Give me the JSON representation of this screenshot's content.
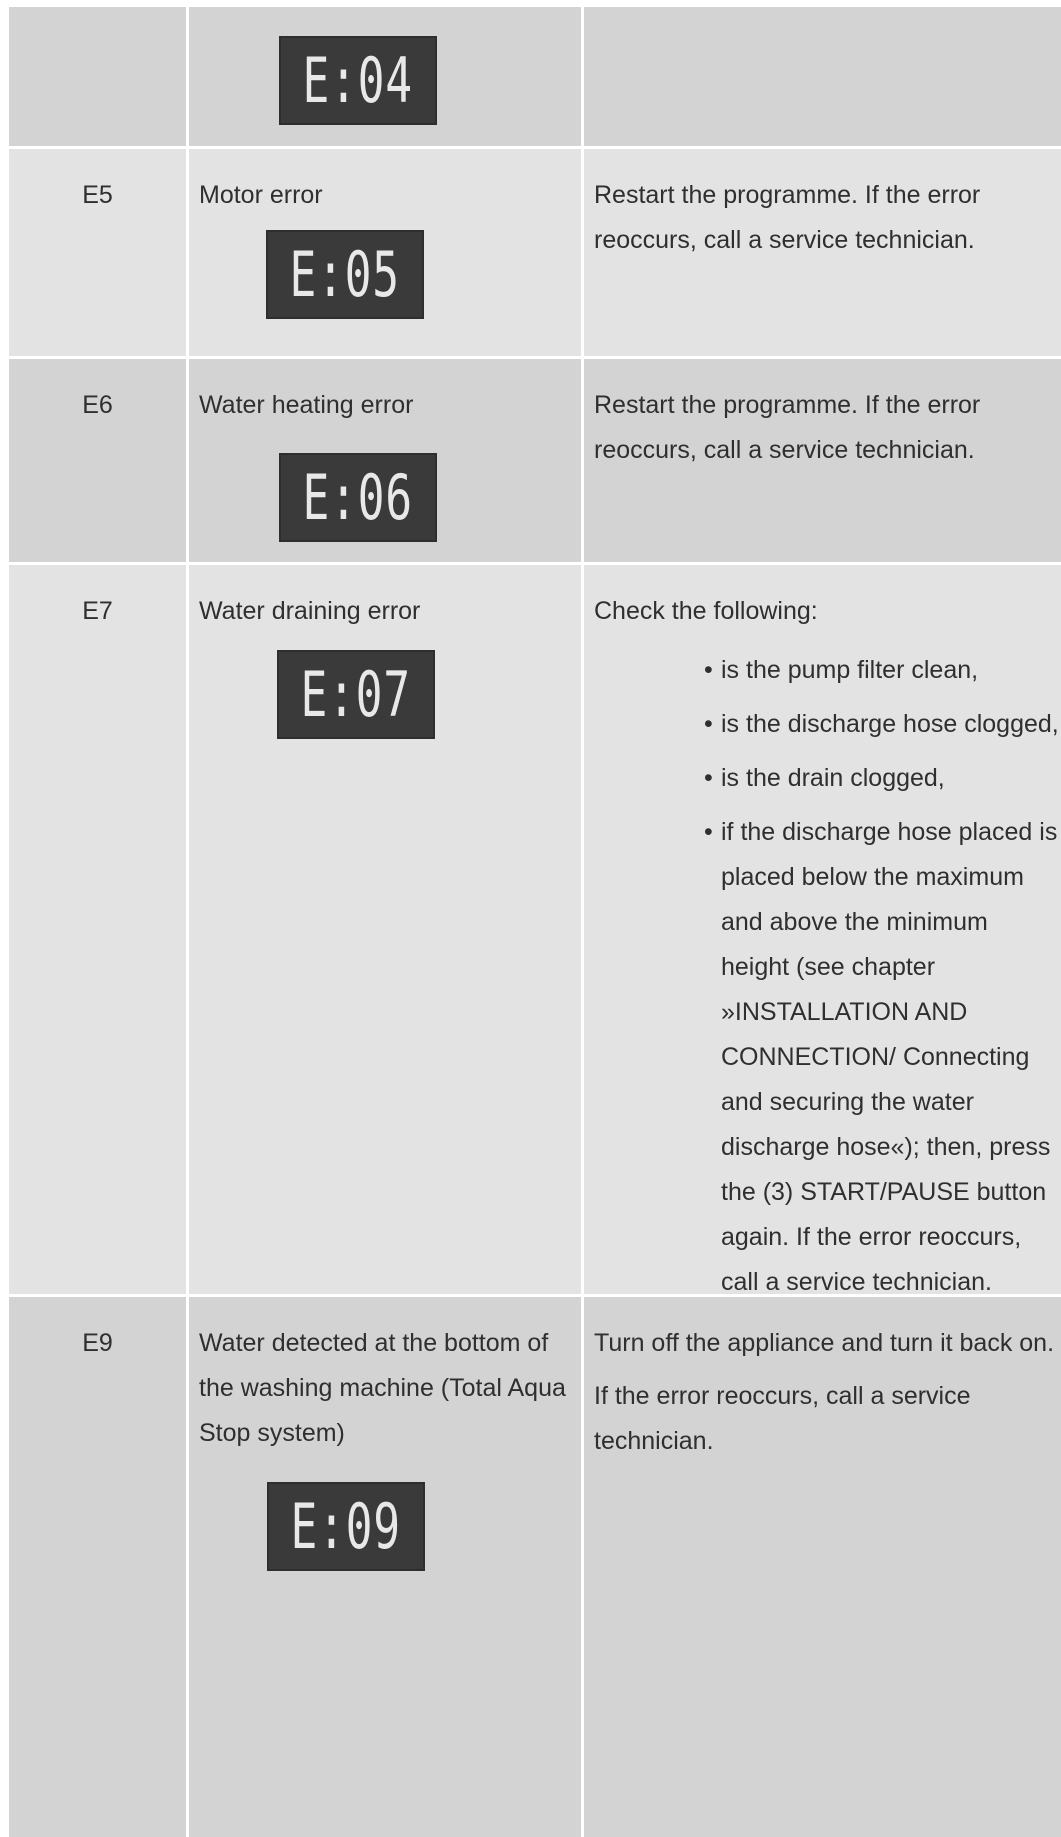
{
  "rows": [
    {
      "code": "",
      "description": "",
      "display": "E:04",
      "solution": ""
    },
    {
      "code": "E5",
      "description": "Motor error",
      "display": "E:05",
      "solution": "Restart the programme. If the error reoccurs, call a service technician."
    },
    {
      "code": "E6",
      "description": "Water heating error",
      "display": "E:06",
      "solution": "Restart the programme. If the error reoccurs, call a service technician."
    },
    {
      "code": "E7",
      "description": "Water draining error",
      "display": "E:07",
      "solution_intro": "Check the following:",
      "checks": [
        "is the pump filter clean,",
        "is the discharge hose clogged,",
        "is the drain clogged,",
        "if the discharge hose placed is placed below the maximum and above the minimum height (see chapter »INSTALLATION AND CONNECTION/ Connecting and securing the water discharge hose«); then, press the (3) START/PAUSE button again. If the error reoccurs, call a service technician."
      ]
    },
    {
      "code": "E9",
      "description": "Water detected at the bottom of the washing machine (Total Aqua Stop system)",
      "display": "E:09",
      "solution_paragraphs": [
        "Turn off the appliance and turn it back on.",
        "If the error reoccurs, call a service technician."
      ]
    }
  ]
}
